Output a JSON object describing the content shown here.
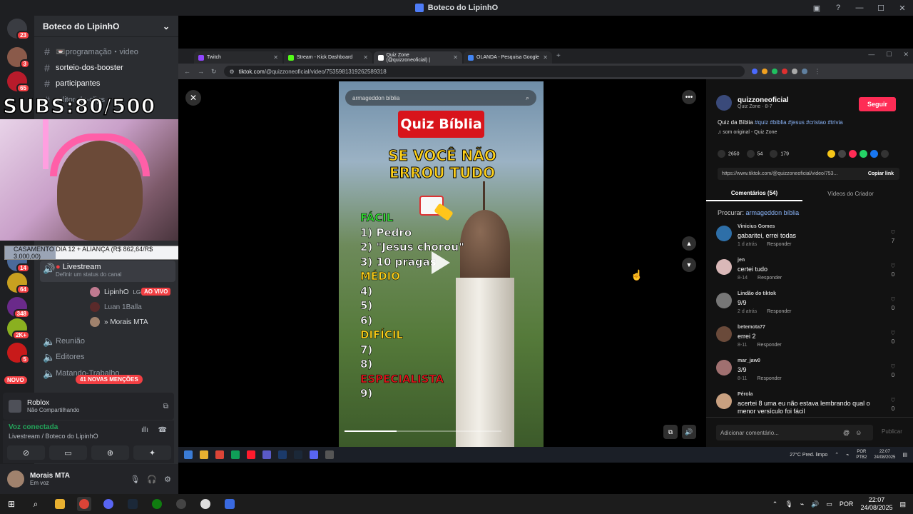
{
  "discord": {
    "window_title": "Boteco do LipinhO",
    "server_name": "Boteco do LipinhO",
    "rail_badges": [
      "23",
      "3",
      "65",
      "14",
      "64",
      "348",
      "2K+",
      "5"
    ],
    "new_label": "NOVO",
    "channels": [
      {
        "name": "📼programação・video"
      },
      {
        "name": "sorteio-dos-booster"
      },
      {
        "name": "participantes"
      },
      {
        "name": "editor-de-clips"
      }
    ],
    "livestream_channel": "Livestream",
    "livestream_status": "Definir um status do canal",
    "voice_users": [
      {
        "name": "LipinhO",
        "tag": "LGC",
        "badge": "AO VIVO"
      },
      {
        "name": "Luan 1Balla"
      },
      {
        "name": "» Morais MTA"
      }
    ],
    "voice_channels": [
      "Reunião",
      "Editores",
      "Matando-Trabalho"
    ],
    "mentions_label": "41 NOVAS MENÇÕES",
    "activity": {
      "game": "Roblox",
      "status": "Não Compartilhando"
    },
    "voice": {
      "title": "Voz conectada",
      "channel": "Livestream / Boteco do LipinhO"
    },
    "user": {
      "name": "Morais MTA",
      "status": "Em voz"
    }
  },
  "overlay": {
    "subs": "SUBS:80/500",
    "goal_text": "CASAMENTO DIA 12 + ALIANÇA (R$ 862,64/R$ 3.000,00)",
    "goal_progress_pct": 28.8
  },
  "browser": {
    "tabs": [
      {
        "label": "Twitch",
        "color": "#9146ff"
      },
      {
        "label": "Stream - Kick Dashboard",
        "color": "#53fc18"
      },
      {
        "label": "Quiz Zone (@quizzoneoficial) |",
        "color": "#ffffff"
      },
      {
        "label": "OLANDA - Pesquisa Google",
        "color": "#4285f4"
      }
    ],
    "url_domain": "tiktok.com",
    "url_path": "/@quizzoneoficial/video/7535981319262589318"
  },
  "tiktok": {
    "video_search": "armageddon bíblia",
    "quiz_title": "Quiz Bíblia",
    "headline": "SE VOCÊ NÃO ERROU TUDO",
    "rows": [
      {
        "text": "FÁCIL",
        "level": "green"
      },
      {
        "text": "1) Pedro",
        "level": "white"
      },
      {
        "text": "2) \"Jesus chorou\"",
        "level": "white"
      },
      {
        "text": "3) 10 pragas",
        "level": "white"
      },
      {
        "text": "MÉDIO",
        "level": "yellow"
      },
      {
        "text": "4)",
        "level": "white"
      },
      {
        "text": "5)",
        "level": "white"
      },
      {
        "text": "6)",
        "level": "white"
      },
      {
        "text": "DIFÍCIL",
        "level": "yellow"
      },
      {
        "text": "7)",
        "level": "white"
      },
      {
        "text": "8)",
        "level": "white"
      },
      {
        "text": "ESPECIALISTA",
        "level": "red"
      },
      {
        "text": "9)",
        "level": "white"
      }
    ],
    "video_progress_pct": 33,
    "author": {
      "name": "quizzoneoficial",
      "sub": "Quiz Zone · 8-7"
    },
    "follow_label": "Seguir",
    "caption_text": "Quiz da Bíblia",
    "caption_tags": "#quiz #biblia #jesus #cristao #trivia",
    "sound": "som original - Quiz Zone",
    "likes": "2650",
    "comments_count": "54",
    "saves": "179",
    "link": "https://www.tiktok.com/@quizzoneoficial/video/753...",
    "copy_label": "Copiar link",
    "tab_comments": "Comentários (54)",
    "tab_videos": "Vídeos do Criador",
    "search_prefix": "Procurar:",
    "search_query": "armageddon bíblia",
    "reply_label": "Responder",
    "comments": [
      {
        "user": "Vinicius Gomes",
        "text": "gabaritei, errei todas",
        "time": "1 d atrás",
        "likes": "7",
        "av": "#2e6fa8"
      },
      {
        "user": "jen",
        "text": "certei tudo",
        "time": "8-14",
        "likes": "0",
        "av": "#d9b8b8"
      },
      {
        "user": "Lindão do tiktok",
        "text": "9/9",
        "time": "2 d atrás",
        "likes": "0",
        "av": "#777777"
      },
      {
        "user": "betemota77",
        "text": "errei 2",
        "time": "8-11",
        "likes": "0",
        "av": "#6a4a3a"
      },
      {
        "user": "mar_jaw0",
        "text": "3/9",
        "time": "8-11",
        "likes": "0",
        "av": "#a07070"
      },
      {
        "user": "Pérola",
        "text": "acertei 8 uma eu não estava lembrando qual o menor versículo foi fácil",
        "time": "",
        "likes": "0",
        "av": "#c8a080"
      }
    ],
    "add_comment_placeholder": "Adicionar comentário...",
    "post_label": "Publicar"
  },
  "inner_tray": {
    "weather": "27°C",
    "weather_desc": "Pred. limpo",
    "lang": "POR",
    "lang2": "PTB2",
    "time": "22:07",
    "date": "24/08/2025"
  },
  "tray": {
    "lang": "POR",
    "time": "22:07",
    "date": "24/08/2025"
  }
}
